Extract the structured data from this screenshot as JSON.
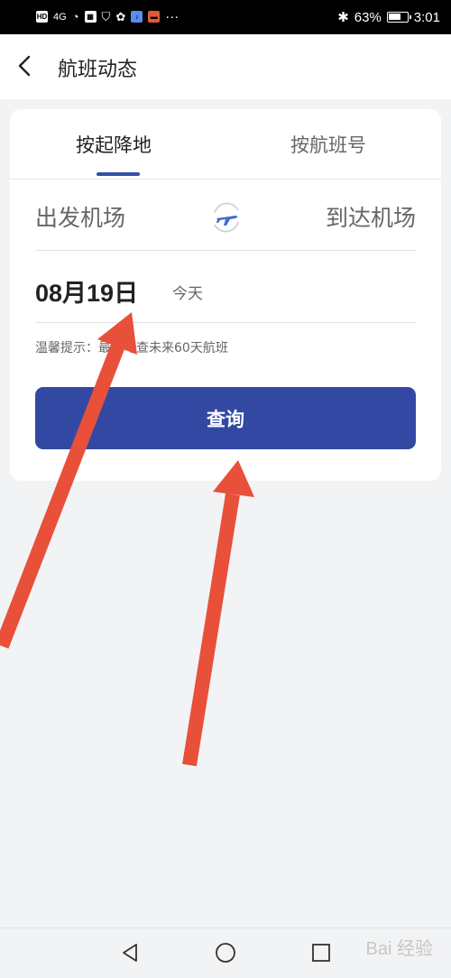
{
  "status_bar": {
    "battery_percent": "63%",
    "battery_level": 0.63,
    "time": "3:01",
    "network": "4G"
  },
  "header": {
    "title": "航班动态"
  },
  "tabs": [
    {
      "label": "按起降地",
      "active": true
    },
    {
      "label": "按航班号",
      "active": false
    }
  ],
  "search": {
    "departure_placeholder": "出发机场",
    "arrival_placeholder": "到达机场",
    "date": "08月19日",
    "date_hint": "今天",
    "tip": "温馨提示：最多可查未来60天航班",
    "query_button": "查询"
  },
  "watermark": "Bai 经验",
  "colors": {
    "accent": "#3348a3",
    "annotation_arrow": "#e8503a"
  }
}
